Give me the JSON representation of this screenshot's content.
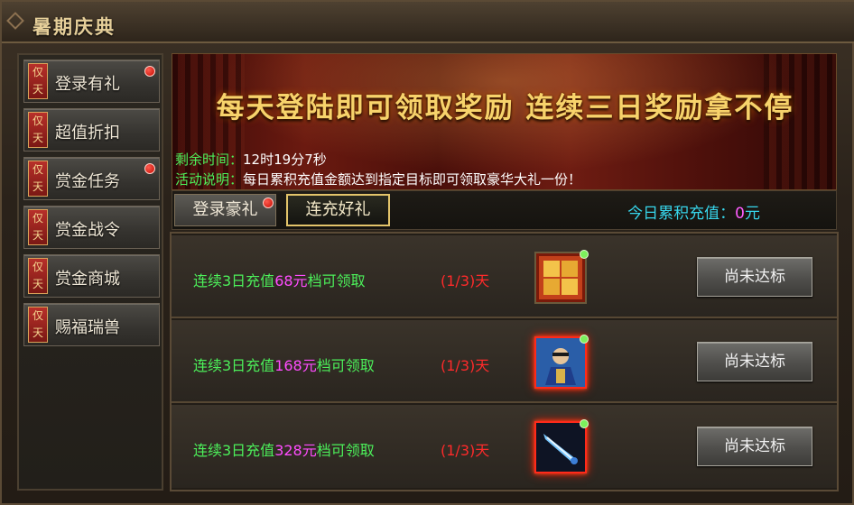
{
  "window": {
    "title": "暑期庆典"
  },
  "sidebar": {
    "items": [
      {
        "tag": "仅天",
        "label": "登录有礼",
        "has_dot": true
      },
      {
        "tag": "仅天",
        "label": "超值折扣",
        "has_dot": false
      },
      {
        "tag": "仅天",
        "label": "赏金任务",
        "has_dot": true
      },
      {
        "tag": "仅天",
        "label": "赏金战令",
        "has_dot": false
      },
      {
        "tag": "仅天",
        "label": "赏金商城",
        "has_dot": false
      },
      {
        "tag": "仅天",
        "label": "赐福瑞兽",
        "has_dot": false
      }
    ]
  },
  "banner": {
    "slogan": "每天登陆即可领取奖励 连续三日奖励拿不停",
    "time_key": "剩余时间：",
    "time_value": "12时19分7秒",
    "desc_key": "活动说明：",
    "desc_value": "每日累积充值金额达到指定目标即可领取豪华大礼一份！"
  },
  "tabs": {
    "login_label": "登录豪礼",
    "recharge_label": "连充好礼",
    "active": "recharge"
  },
  "today": {
    "label": "今日累积充值：",
    "amount": "0",
    "unit": "元"
  },
  "rows": [
    {
      "prefix": "连续3日充值",
      "amount": "68元",
      "suffix": "档可领取",
      "progress": "(1/3)天",
      "reward_icon": "summer-carnival-icon",
      "button": "尚未达标"
    },
    {
      "prefix": "连续3日充值",
      "amount": "168元",
      "suffix": "档可领取",
      "progress": "(1/3)天",
      "reward_icon": "phantom-character-icon",
      "button": "尚未达标"
    },
    {
      "prefix": "连续3日充值",
      "amount": "328元",
      "suffix": "档可领取",
      "progress": "(1/3)天",
      "reward_icon": "phantom-blade-icon",
      "button": "尚未达标"
    }
  ],
  "colors": {
    "accent_green": "#4cf05a",
    "accent_magenta": "#ff4cff",
    "progress_red": "#ff2a2a",
    "today_cyan": "#37d6ec",
    "gold": "#f7d36b"
  }
}
